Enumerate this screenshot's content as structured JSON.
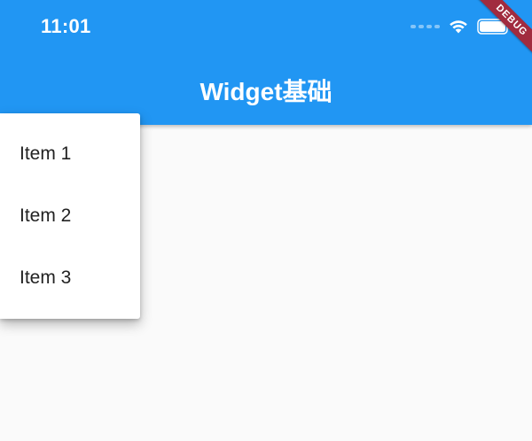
{
  "status_bar": {
    "time": "11:01"
  },
  "app_bar": {
    "title": "Widget基础",
    "background_color": "#2196f3"
  },
  "debug_banner": {
    "label": "DEBUG",
    "color": "#a12b3f"
  },
  "popup_menu": {
    "items": [
      {
        "label": "Item 1"
      },
      {
        "label": "Item 2"
      },
      {
        "label": "Item 3"
      }
    ]
  },
  "icons": {
    "status": [
      "signal-icon",
      "wifi-icon",
      "battery-icon"
    ]
  }
}
